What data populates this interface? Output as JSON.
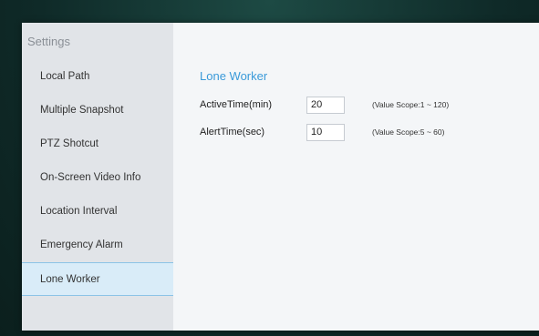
{
  "sidebar": {
    "title": "Settings",
    "items": [
      {
        "label": "Local Path"
      },
      {
        "label": "Multiple Snapshot"
      },
      {
        "label": "PTZ Shotcut"
      },
      {
        "label": "On-Screen Video Info"
      },
      {
        "label": "Location Interval"
      },
      {
        "label": "Emergency Alarm"
      },
      {
        "label": "Lone Worker",
        "active": true
      }
    ]
  },
  "main": {
    "section_title": "Lone Worker",
    "fields": [
      {
        "label": "ActiveTime(min)",
        "value": "20",
        "hint": "(Value Scope:1 ~ 120)"
      },
      {
        "label": "AlertTime(sec)",
        "value": "10",
        "hint": "(Value Scope:5 ~ 60)"
      }
    ]
  },
  "colors": {
    "accent": "#3a9ad9",
    "sidebar_bg": "#e1e4e8",
    "active_item_bg": "#d9ecf8",
    "background": "#0f2a28"
  }
}
